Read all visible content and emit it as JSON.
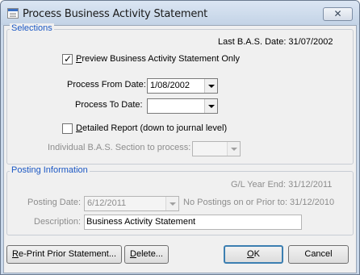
{
  "window": {
    "title": "Process Business Activity Statement"
  },
  "icons": {
    "app": "document-window-icon",
    "close": "close-icon",
    "dropdown": "chevron-down-icon",
    "check": "checkmark-icon"
  },
  "selections": {
    "group_title": "Selections",
    "last_bas_date": "Last B.A.S. Date: 31/07/2002",
    "preview_checked": true,
    "preview_label_first": "P",
    "preview_label_rest": "review Business Activity Statement Only",
    "process_from_label": "Process From Date:",
    "process_from_value": "1/08/2002",
    "process_to_label": "Process To Date:",
    "process_to_value": "",
    "detailed_checked": false,
    "detailed_label_first": "D",
    "detailed_label_rest": "etailed Report (down to journal level)",
    "individual_section_label": "Individual B.A.S. Section to process:",
    "individual_section_value": ""
  },
  "posting": {
    "group_title": "Posting Information",
    "gl_year_end": "G/L Year End: 31/12/2011",
    "posting_date_label": "Posting Date:",
    "posting_date_value": "6/12/2011",
    "no_postings_note": "No Postings on or Prior to: 31/12/2010",
    "description_label": "Description:",
    "description_value": "Business Activity Statement"
  },
  "buttons": {
    "reprint_first": "R",
    "reprint_rest": "e-Print Prior Statement...",
    "delete_first": "D",
    "delete_rest": "elete...",
    "ok_first": "O",
    "ok_rest": "K",
    "cancel": "Cancel"
  },
  "colors": {
    "group_title": "#1c58c4",
    "disabled_text": "#8d8d8d",
    "title_bar": "#c9d8ea"
  }
}
